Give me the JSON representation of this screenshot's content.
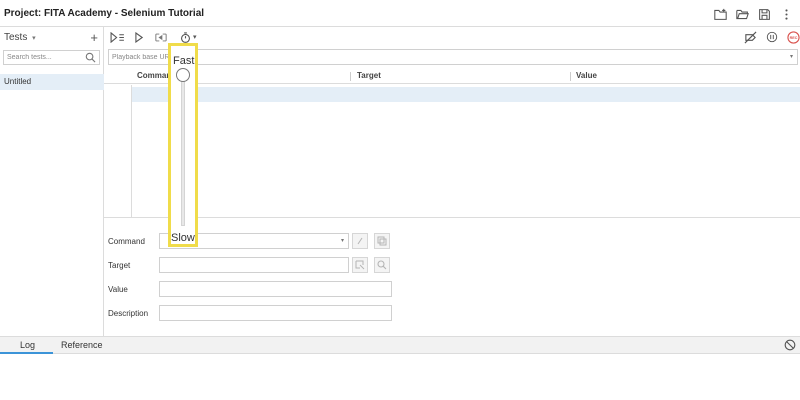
{
  "window": {
    "title": "Project:  FITA Academy - Selenium Tutorial",
    "actions": [
      {
        "name": "new-folder-icon"
      },
      {
        "name": "open-folder-icon"
      },
      {
        "name": "save-icon"
      },
      {
        "name": "more-vertical-icon"
      }
    ]
  },
  "sidebar": {
    "header_label": "Tests",
    "header_caret": "▾",
    "add_glyph": "+",
    "search_placeholder": "Search tests...",
    "items": [
      {
        "label": "Untitled",
        "selected": true
      }
    ]
  },
  "toolbar": {
    "left_icons": [
      "run-all-tests-icon",
      "run-current-test-icon",
      "step-over-icon",
      "speed-timer-icon"
    ],
    "speed_caret": "▾",
    "right_icons": [
      "disable-breakpoints-icon",
      "pause-on-exceptions-icon",
      "record-icon"
    ],
    "record_label": "REC"
  },
  "url_bar": {
    "placeholder": "Playback base URL",
    "caret": "▾"
  },
  "table": {
    "columns": [
      "Command",
      "Target",
      "Value"
    ]
  },
  "editor": {
    "command_label": "Command",
    "target_label": "Target",
    "value_label": "Value",
    "description_label": "Description",
    "command_caret": "▾"
  },
  "bottom_panel": {
    "tabs": [
      {
        "label": "Log",
        "active": true
      },
      {
        "label": "Reference",
        "active": false
      }
    ]
  },
  "speed_slider": {
    "top_label": "Fast",
    "bottom_label": "Slow",
    "level_fraction": 1.0,
    "highlight_color": "#f0dc4a"
  },
  "colors": {
    "accent": "#3c94d8",
    "selection": "#e4eef7",
    "record": "#d9534f"
  }
}
